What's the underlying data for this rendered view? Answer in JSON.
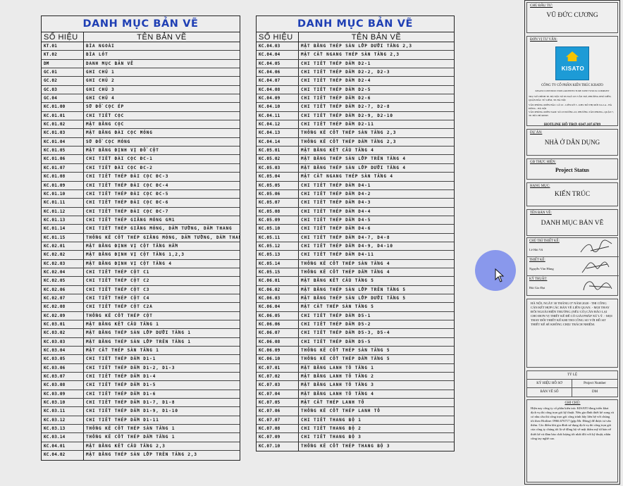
{
  "left_list": {
    "title": "DANH MỤC BẢN VẼ",
    "col_code": "SỐ HIỆU",
    "col_name": "TÊN BẢN VẼ",
    "rows": [
      [
        "KT.01",
        "BÌA NGOÀI"
      ],
      [
        "KT.02",
        "BÌA LÓT"
      ],
      [
        "DM",
        "DANH MỤC BẢN VẼ"
      ],
      [
        "GC.01",
        "GHI CHÚ 1"
      ],
      [
        "GC.02",
        "GHI CHÚ 2"
      ],
      [
        "GC.03",
        "GHI CHÚ 3"
      ],
      [
        "GC.04",
        "GHI CHÚ 4"
      ],
      [
        "KC.01.00",
        "SƠ ĐỒ CỌC ÉP"
      ],
      [
        "KC.01.01",
        "CHI TIẾT CỌC"
      ],
      [
        "KC.01.02",
        "MẶT BẰNG CỌC"
      ],
      [
        "KC.01.03",
        "MẶT BẰNG ĐÀI CỌC MÓNG"
      ],
      [
        "KC.01.04",
        "SƠ ĐỒ CỌC MÓNG"
      ],
      [
        "KC.01.05",
        "MẶT BẰNG ĐỊNH VỊ ĐỔ CỘT"
      ],
      [
        "KC.01.06",
        "CHI TIẾT ĐÀI CỌC ĐC-1"
      ],
      [
        "KC.01.07",
        "CHI TIẾT ĐÀI CỌC ĐC-2"
      ],
      [
        "KC.01.08",
        "CHI TIẾT THÉP ĐÀI CỌC ĐC-3"
      ],
      [
        "KC.01.09",
        "CHI TIẾT THÉP ĐÀI CỌC ĐC-4"
      ],
      [
        "KC.01.10",
        "CHI TIẾT THÉP ĐÀI CỌC ĐC-5"
      ],
      [
        "KC.01.11",
        "CHI TIẾT THÉP ĐÀI CỌC ĐC-6"
      ],
      [
        "KC.01.12",
        "CHI TIẾT THÉP ĐÀI CỌC ĐC-7"
      ],
      [
        "KC.01.13",
        "CHI TIẾT THÉP GIẰNG MÓNG GM1"
      ],
      [
        "KC.01.14",
        "CHI TIẾT THÉP GIẰNG MÓNG, DẦM TƯỜNG, DẦM THANG"
      ],
      [
        "KC.01.15",
        "THỐNG KÊ CỐT THÉP GIẰNG MÓNG, DẦM TƯỜNG, DẦM THANG"
      ],
      [
        "KC.02.01",
        "MẶT BẰNG ĐỊNH VỊ CỘT TẦNG HẦM"
      ],
      [
        "KC.02.02",
        "MẶT BẰNG ĐỊNH VỊ CỘT TẦNG 1,2,3"
      ],
      [
        "KC.02.03",
        "MẶT BẰNG ĐỊNH VỊ CỘT TẦNG 4"
      ],
      [
        "KC.02.04",
        "CHI TIẾT THÉP CỘT C1"
      ],
      [
        "KC.02.05",
        "CHI TIẾT THÉP CỘT C2"
      ],
      [
        "KC.02.06",
        "CHI TIẾT THÉP CỘT C3"
      ],
      [
        "KC.02.07",
        "CHI TIẾT THÉP CỘT C4"
      ],
      [
        "KC.02.08",
        "CHI TIẾT THÉP CỘT C2A"
      ],
      [
        "KC.02.09",
        "THỐNG KÊ CỐT THÉP CỘT"
      ],
      [
        "KC.03.01",
        "MẶT BẰNG KẾT CẤU TẦNG 1"
      ],
      [
        "KC.03.02",
        "MẶT BẰNG THÉP SÀN LỚP DƯỚI TẦNG 1"
      ],
      [
        "KC.03.03",
        "MẶT BẰNG THÉP SÀN LỚP TRÊN TẦNG 1"
      ],
      [
        "KC.03.04",
        "MẶT CẮT THÉP SÀN TẦNG 1"
      ],
      [
        "KC.03.05",
        "CHI TIẾT THÉP DẦM D1-1"
      ],
      [
        "KC.03.06",
        "CHI TIẾT THÉP DẦM D1-2, D1-3"
      ],
      [
        "KC.03.07",
        "CHI TIẾT THÉP DẦM D1-4"
      ],
      [
        "KC.03.08",
        "CHI TIẾT THÉP DẦM D1-5"
      ],
      [
        "KC.03.09",
        "CHI TIẾT THÉP DẦM D1-6"
      ],
      [
        "KC.03.10",
        "CHI TIẾT THÉP DẦM D1-7, D1-8"
      ],
      [
        "KC.03.11",
        "CHI TIẾT THÉP DẦM D1-9, D1-10"
      ],
      [
        "KC.03.12",
        "CHI TIẾT THÉP DẦM D1-11"
      ],
      [
        "KC.03.13",
        "THỐNG KÊ CỐT THÉP SÀN TẦNG 1"
      ],
      [
        "KC.03.14",
        "THỐNG KÊ CỐT THÉP DẦM TẦNG 1"
      ],
      [
        "KC.04.01",
        "MẶT BẰNG KẾT CẤU TẦNG 2,3"
      ],
      [
        "KC.04.02",
        "MẶT BẰNG THÉP SÀN LỚP TRÊN TẦNG 2,3"
      ]
    ]
  },
  "right_list": {
    "title": "DANH MỤC BẢN VẼ",
    "col_code": "SỐ HIỆU",
    "col_name": "TÊN BẢN VẼ",
    "rows": [
      [
        "KC.04.03",
        "MẶT BẰNG THÉP SÀN LỚP DƯỚI TẦNG 2,3"
      ],
      [
        "KC.04.04",
        "MẶT CẮT NGANG THÉP SÀN TẦNG 2,3"
      ],
      [
        "KC.04.05",
        "CHI TIẾT THÉP DẦM D2-1"
      ],
      [
        "KC.04.06",
        "CHI TIẾT THÉP DẦM D2-2, D2-3"
      ],
      [
        "KC.04.07",
        "CHI TIẾT THÉP DẦM D2-4"
      ],
      [
        "KC.04.08",
        "CHI TIẾT THÉP DẦM D2-5"
      ],
      [
        "KC.04.09",
        "CHI TIẾT THÉP DẦM D2-6"
      ],
      [
        "KC.04.10",
        "CHI TIẾT THÉP DẦM D2-7, D2-8"
      ],
      [
        "KC.04.11",
        "CHI TIẾT THÉP DẦM D2-9, D2-10"
      ],
      [
        "KC.04.12",
        "CHI TIẾT THÉP DẦM D2-11"
      ],
      [
        "KC.04.13",
        "THỐNG KÊ CỐT THÉP SÀN TẦNG 2,3"
      ],
      [
        "KC.04.14",
        "THỐNG KÊ CỐT THÉP DẦM TẦNG 2,3"
      ],
      [
        "KC.05.01",
        "MẶT BẰNG KẾT CẤU TẦNG 4"
      ],
      [
        "KC.05.02",
        "MẶT BẰNG THÉP SÀN LỚP TRÊN TẦNG 4"
      ],
      [
        "KC.05.03",
        "MẶT BẰNG THÉP SÀN LỚP DƯỚI TẦNG 4"
      ],
      [
        "KC.05.04",
        "MẶT CẮT NGANG THÉP SÀN TẦNG 4"
      ],
      [
        "KC.05.05",
        "CHI TIẾT THÉP DẦM D4-1"
      ],
      [
        "KC.05.06",
        "CHI TIẾT THÉP DẦM D4-2"
      ],
      [
        "KC.05.07",
        "CHI TIẾT THÉP DẦM D4-3"
      ],
      [
        "KC.05.08",
        "CHI TIẾT THÉP DẦM D4-4"
      ],
      [
        "KC.05.09",
        "CHI TIẾT THÉP DẦM D4-5"
      ],
      [
        "KC.05.10",
        "CHI TIẾT THÉP DẦM D4-6"
      ],
      [
        "KC.05.11",
        "CHI TIẾT THÉP DẦM D4-7, D4-8"
      ],
      [
        "KC.05.12",
        "CHI TIẾT THÉP DẦM D4-9, D4-10"
      ],
      [
        "KC.05.13",
        "CHI TIẾT THÉP DẦM D4-11"
      ],
      [
        "KC.05.14",
        "THỐNG KÊ CỐT THÉP SÀN TẦNG 4"
      ],
      [
        "KC.05.15",
        "THỐNG KÊ CỐT THÉP DẦM TẦNG 4"
      ],
      [
        "KC.06.01",
        "MẶT BẰNG KẾT CẤU TẦNG 5"
      ],
      [
        "KC.06.02",
        "MẶT BẰNG THÉP SÀN LỚP TRÊN TẦNG 5"
      ],
      [
        "KC.06.03",
        "MẶT BẰNG THÉP SÀN LỚP DƯỚI TẦNG 5"
      ],
      [
        "KC.06.04",
        "MẶT CẮT THÉP SÀN TẦNG 5"
      ],
      [
        "KC.06.05",
        "CHI TIẾT THÉP DẦM D5-1"
      ],
      [
        "KC.06.06",
        "CHI TIẾT THÉP DẦM D5-2"
      ],
      [
        "KC.06.07",
        "CHI TIẾT THÉP DẦM D5-3, D5-4"
      ],
      [
        "KC.06.08",
        "CHI TIẾT THÉP DẦM D5-5"
      ],
      [
        "KC.06.09",
        "THỐNG KÊ CỐT THÉP SÀN TẦNG 5"
      ],
      [
        "KC.06.10",
        "THỐNG KÊ CỐT THÉP DẦM TẦNG 5"
      ],
      [
        "KC.07.01",
        "MẶT BẰNG LANH TÔ TẦNG 1"
      ],
      [
        "KC.07.02",
        "MẶT BẰNG LANH TÔ TẦNG 2"
      ],
      [
        "KC.07.03",
        "MẶT BẰNG LANH TÔ TẦNG 3"
      ],
      [
        "KC.07.04",
        "MẶT BẰNG LANH TÔ TẦNG 4"
      ],
      [
        "KC.07.05",
        "MẶT CẮT THÉP LANH TÔ"
      ],
      [
        "KC.07.06",
        "THỐNG KÊ CỐT THÉP LANH TÔ"
      ],
      [
        "KC.07.07",
        "CHI TIẾT THANG BỘ 1"
      ],
      [
        "KC.07.08",
        "CHI TIẾT THANG BỘ 2"
      ],
      [
        "KC.07.09",
        "CHI TIẾT THANG BỘ 3"
      ],
      [
        "KC.07.10",
        "THỐNG KÊ CỐT THÉP THANG BỘ 3"
      ]
    ]
  },
  "title_block": {
    "owner_label": "CHỦ ĐẦU TƯ:",
    "owner": "VŨ ĐỨC CƯƠNG",
    "consultant_label": "ĐƠN VỊ TƯ VẤN:",
    "logo_text": "KISATO",
    "company": "CÔNG TY CỔ PHẦN KIẾN TRÚC KISATO",
    "company_en": "KISATO CONSTRUCTION ARCHITECTURE JOINT STOCK COMPANY",
    "address_1": "TRỤ SỞ CHÍNH TP. HÀ NỘI: SỐ 83 NGÕ 105 VĂN TRÌ, PHƯỜNG PHÚ DIỄN, QUẬN BẮC TỪ LIÊM, TP. HÀ NỘI",
    "address_2": "VĂN PHÒNG MIỀN BẮC: LÔ 10 - LIỀN KỀ 3 - KHU ĐÔ THỊ MỚI XA LA - HÀ ĐÔNG - HÀ NỘI",
    "address_3": "VĂN PHÒNG MIỀN NAM: SỐ 23 ĐƯỜNG 43, PHƯỜNG TÂN PHONG, QUẬN 7, TP. HỒ CHÍ MINH",
    "hotline": "HOTLINE HỖ TRỢ: 0347.107.6789",
    "project_label": "DỰ ÁN:",
    "project": "NHÀ Ở DÂN DỤNG",
    "stage_label": "GĐ THỰC HIỆN:",
    "stage": "Project Status",
    "category_label": "HẠNG MỤC:",
    "category": "KIẾN TRÚC",
    "drawing_label": "TÊN BẢN VẼ:",
    "drawing": "DANH MỤC BẢN VẼ",
    "lead_label": "CHỦ TRÌ THIẾT KẾ:",
    "lead_name": "Lê Hải Vũ",
    "designer_label": "THIẾT KẾ:",
    "designer_name": "Nguyễn Văn Hùng",
    "checker_label": "KỸ THUẬT:",
    "checker_name": "Bùi Gia Đạt",
    "notice": "HÀ NỘI, NGÀY 30 THÁNG 07 NĂM 2020 - THI CÔNG CĂN KẾT HỢP CÁC BẢN VẼ LIÊN QUAN. - MỌI THAY ĐỔI NGOÀI HIỆN TRƯỜNG (NẾU CÓ) CẦN BÁO LẠI CHO ĐƠN VỊ THIẾT KẾ ĐỂ CÓ GIẢI PHÁP XỬ LÝ. - MỌI THAY ĐỔI THIẾT KẾ KHI THI CÔNG SO VỚI HỒ SƠ THIẾT KẾ SẼ KHÔNG CHỊU TRÁCH NHIỆM.",
    "scale_label": "TỶ LỆ",
    "file_label": "KÝ HIỆU HỒ SƠ",
    "file_value": "Project Number",
    "sheet_label": "BẢN VẼ SỐ",
    "sheet_value": "DM",
    "footnote_label": "GHI CHÚ:",
    "footnote": "Hiện nay công ty cổ phần kiến trúc KISATO đang triển khai dịch vụ thi công trọn gói kỹ thuật. Nếu gia đình thiết kế xong và có nhu cầu thi công trọn gói công trình hãy liên hệ với chúng tôi theo Hotline: 0966.676717 (gặp Mr. Đông) để được tư vấn thêm. Các điểm khi gia đình sử dụng dịch vụ thi công trọn gói của công ty chúng tôi là sẽ đồng bộ về mặt thẩm mỹ từ bản vẽ thiết kế và đảm bảo chất lượng tốt nhất đối với kỹ thuật, nhân công tay nghề cao."
  },
  "colors": {
    "title_blue": "#1f3fb4",
    "logo_blue": "#1d9bd6",
    "logo_yellow": "#f5c400",
    "cursor_halo": "#788aec"
  }
}
